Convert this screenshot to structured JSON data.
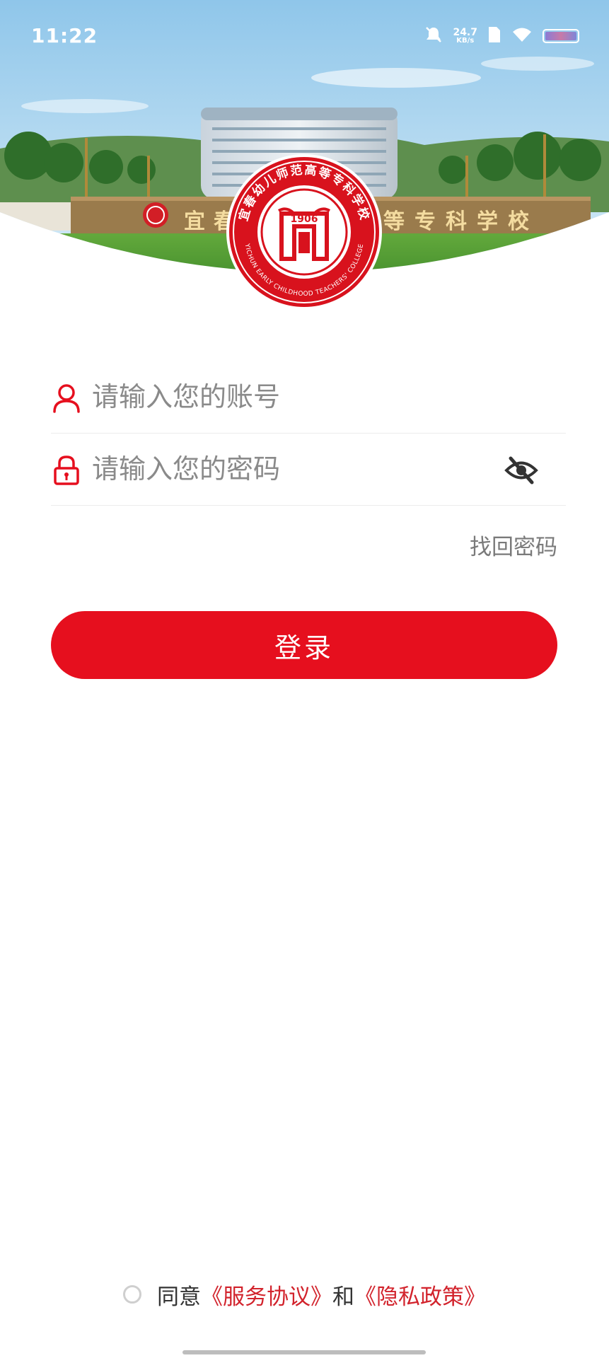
{
  "status_bar": {
    "time": "11:22",
    "net_speed_value": "24.7",
    "net_speed_unit": "KB/s",
    "icons": [
      "mute-bell-icon",
      "sim-icon",
      "wifi-icon",
      "battery-icon"
    ]
  },
  "hero": {
    "campus_sign": [
      "宜",
      "春",
      "等",
      "专",
      "科",
      "学",
      "校"
    ],
    "emblem": {
      "year": "1906",
      "arc_chinese": "宜春幼儿师范高等专科学校",
      "arc_english": "YICHUN EARLY CHILDHOOD TEACHERS' COLLEGE"
    }
  },
  "login": {
    "account_placeholder": "请输入您的账号",
    "password_placeholder": "请输入您的密码",
    "forgot_password": "找回密码",
    "submit_label": "登录"
  },
  "agreement": {
    "prefix": "同意",
    "service_link": "《服务协议》",
    "conjunction": "和",
    "privacy_link": "《隐私政策》"
  },
  "colors": {
    "brand_red": "#e60f1e",
    "link_red": "#d2232c",
    "placeholder_gray": "#8a8a8a"
  }
}
